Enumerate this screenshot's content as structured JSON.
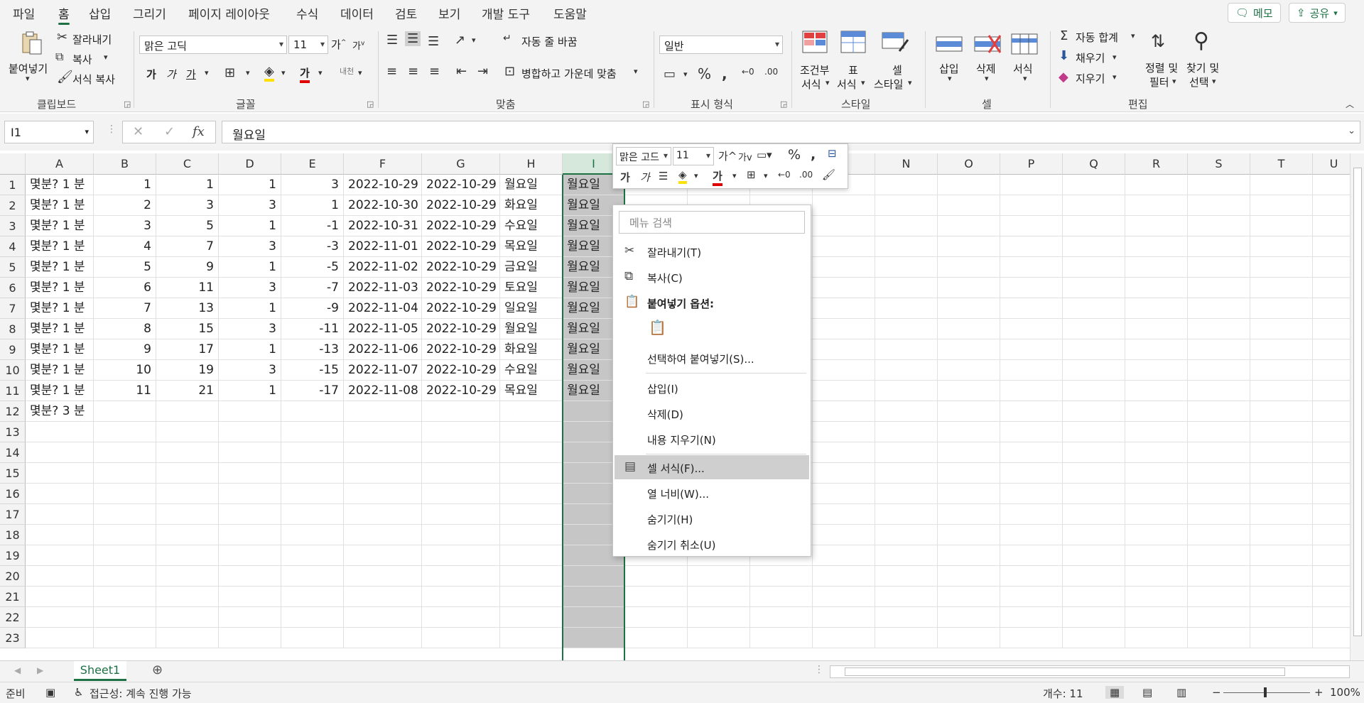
{
  "tabs": [
    "파일",
    "홈",
    "삽입",
    "그리기",
    "페이지 레이아웃",
    "수식",
    "데이터",
    "검토",
    "보기",
    "개발 도구",
    "도움말"
  ],
  "active_tab": "홈",
  "top_buttons": {
    "memo": "메모",
    "share": "공유"
  },
  "ribbon": {
    "clipboard": {
      "paste": "붙여넣기",
      "cut": "잘라내기",
      "copy": "복사",
      "format_painter": "서식 복사",
      "label": "클립보드"
    },
    "font": {
      "name": "맑은 고딕",
      "size": "11",
      "label": "글꼴"
    },
    "align": {
      "wrap": "자동 줄 바꿈",
      "merge": "병합하고 가운데 맞춤",
      "label": "맞춤"
    },
    "number": {
      "format": "일반",
      "label": "표시 형식"
    },
    "styles": {
      "cond_line1": "조건부",
      "cond_line2": "서식",
      "table_line1": "표",
      "table_line2": "서식",
      "cell_line1": "셀",
      "cell_line2": "스타일",
      "label": "스타일"
    },
    "cells": {
      "insert": "삽입",
      "delete": "삭제",
      "format": "서식",
      "label": "셀"
    },
    "editing": {
      "autosum": "자동 합계",
      "fill": "채우기",
      "clear": "지우기",
      "sort_line1": "정렬 및",
      "sort_line2": "필터",
      "find_line1": "찾기 및",
      "find_line2": "선택",
      "label": "편집"
    }
  },
  "formula_bar": {
    "name_box": "I1",
    "fx": "fx",
    "formula": "월요일"
  },
  "columns": [
    "A",
    "B",
    "C",
    "D",
    "E",
    "F",
    "G",
    "H",
    "I",
    "J",
    "K",
    "L",
    "M",
    "N",
    "O",
    "P",
    "Q",
    "R",
    "S",
    "T",
    "U"
  ],
  "rows": [
    [
      "몇분? 1 분",
      "1",
      "1",
      "1",
      "3",
      "2022-10-29",
      "2022-10-29",
      "월요일",
      "월요일"
    ],
    [
      "몇분? 1 분",
      "2",
      "3",
      "3",
      "1",
      "2022-10-30",
      "2022-10-29",
      "화요일",
      "월요일"
    ],
    [
      "몇분? 1 분",
      "3",
      "5",
      "1",
      "-1",
      "2022-10-31",
      "2022-10-29",
      "수요일",
      "월요일"
    ],
    [
      "몇분? 1 분",
      "4",
      "7",
      "3",
      "-3",
      "2022-11-01",
      "2022-10-29",
      "목요일",
      "월요일"
    ],
    [
      "몇분? 1 분",
      "5",
      "9",
      "1",
      "-5",
      "2022-11-02",
      "2022-10-29",
      "금요일",
      "월요일"
    ],
    [
      "몇분? 1 분",
      "6",
      "11",
      "3",
      "-7",
      "2022-11-03",
      "2022-10-29",
      "토요일",
      "월요일"
    ],
    [
      "몇분? 1 분",
      "7",
      "13",
      "1",
      "-9",
      "2022-11-04",
      "2022-10-29",
      "일요일",
      "월요일"
    ],
    [
      "몇분? 1 분",
      "8",
      "15",
      "3",
      "-11",
      "2022-11-05",
      "2022-10-29",
      "월요일",
      "월요일"
    ],
    [
      "몇분? 1 분",
      "9",
      "17",
      "1",
      "-13",
      "2022-11-06",
      "2022-10-29",
      "화요일",
      "월요일"
    ],
    [
      "몇분? 1 분",
      "10",
      "19",
      "3",
      "-15",
      "2022-11-07",
      "2022-10-29",
      "수요일",
      "월요일"
    ],
    [
      "몇분? 1 분",
      "11",
      "21",
      "1",
      "-17",
      "2022-11-08",
      "2022-10-29",
      "목요일",
      "월요일"
    ],
    [
      "몇분? 3 분",
      "",
      "",
      "",
      "",
      "",
      "",
      "",
      ""
    ]
  ],
  "row_count": 23,
  "mini_toolbar": {
    "font": "맑은 고드",
    "size": "11"
  },
  "context_menu": {
    "search_placeholder": "메뉴 검색",
    "items": [
      {
        "label": "잘라내기(T)",
        "icon": "scissors-icon"
      },
      {
        "label": "복사(C)",
        "icon": "copy-icon"
      },
      {
        "label": "붙여넣기 옵션:",
        "icon": "paste-icon"
      },
      {
        "label": "선택하여 붙여넣기(S)...",
        "icon": ""
      },
      {
        "label": "삽입(I)",
        "icon": ""
      },
      {
        "label": "삭제(D)",
        "icon": ""
      },
      {
        "label": "내용 지우기(N)",
        "icon": ""
      },
      {
        "label": "셀 서식(F)...",
        "icon": "format-cells-icon"
      },
      {
        "label": "열 너비(W)...",
        "icon": ""
      },
      {
        "label": "숨기기(H)",
        "icon": ""
      },
      {
        "label": "숨기기 취소(U)",
        "icon": ""
      }
    ]
  },
  "sheet_tab": "Sheet1",
  "status": {
    "ready": "준비",
    "accessibility": "접근성: 계속 진행 가능",
    "count": "개수: 11",
    "zoom": "100%"
  },
  "colors": {
    "accent": "#1e7145",
    "selected_column": "#c6c6c6"
  }
}
